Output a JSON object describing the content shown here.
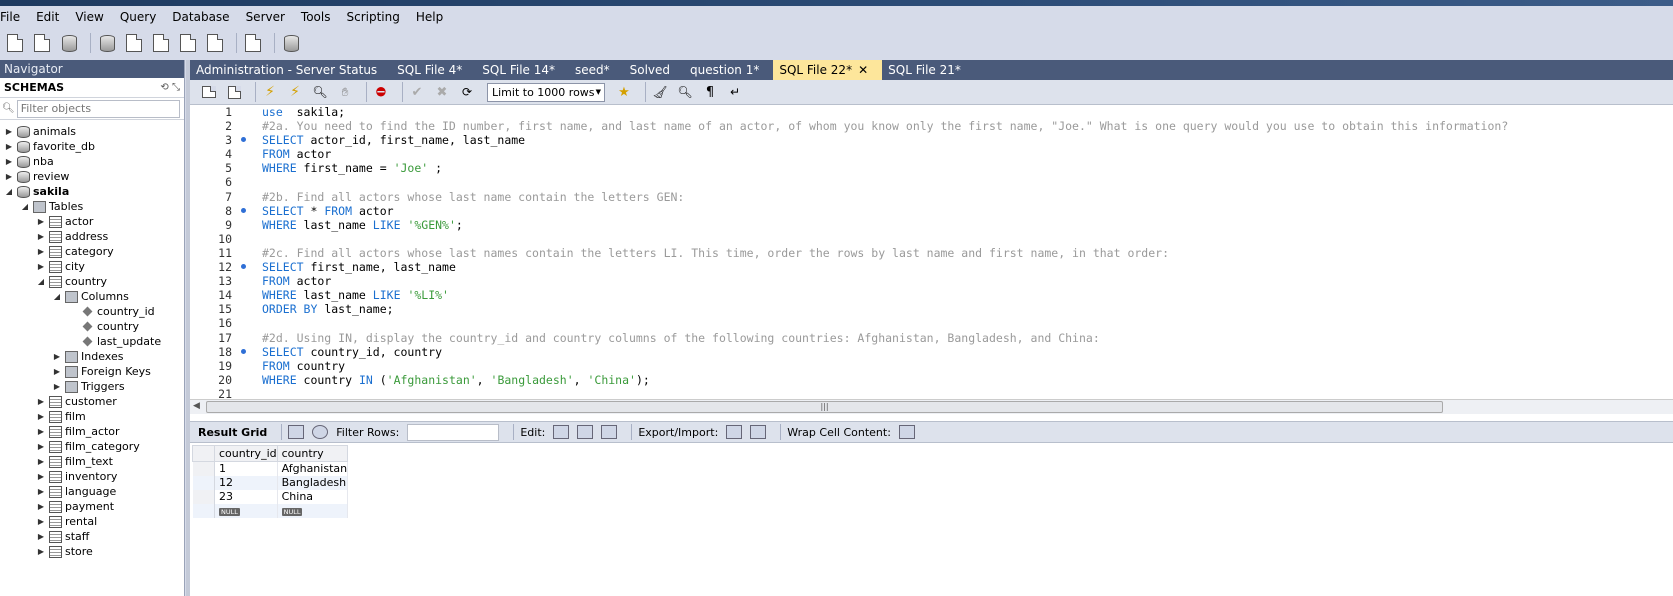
{
  "menu": [
    "File",
    "Edit",
    "View",
    "Query",
    "Database",
    "Server",
    "Tools",
    "Scripting",
    "Help"
  ],
  "navigator": {
    "title": "Navigator",
    "schemas_label": "SCHEMAS",
    "filter_placeholder": "Filter objects",
    "tree": [
      {
        "label": "animals",
        "level": 0,
        "icon": "db",
        "arrow": "right"
      },
      {
        "label": "favorite_db",
        "level": 0,
        "icon": "db",
        "arrow": "right"
      },
      {
        "label": "nba",
        "level": 0,
        "icon": "db",
        "arrow": "right"
      },
      {
        "label": "review",
        "level": 0,
        "icon": "db",
        "arrow": "right"
      },
      {
        "label": "sakila",
        "level": 0,
        "icon": "db",
        "arrow": "down",
        "bold": true
      },
      {
        "label": "Tables",
        "level": 1,
        "icon": "folder",
        "arrow": "down"
      },
      {
        "label": "actor",
        "level": 2,
        "icon": "table",
        "arrow": "right"
      },
      {
        "label": "address",
        "level": 2,
        "icon": "table",
        "arrow": "right"
      },
      {
        "label": "category",
        "level": 2,
        "icon": "table",
        "arrow": "right"
      },
      {
        "label": "city",
        "level": 2,
        "icon": "table",
        "arrow": "right"
      },
      {
        "label": "country",
        "level": 2,
        "icon": "table",
        "arrow": "down"
      },
      {
        "label": "Columns",
        "level": 3,
        "icon": "folder",
        "arrow": "down"
      },
      {
        "label": "country_id",
        "level": 4,
        "icon": "column",
        "arrow": ""
      },
      {
        "label": "country",
        "level": 4,
        "icon": "column",
        "arrow": ""
      },
      {
        "label": "last_update",
        "level": 4,
        "icon": "column",
        "arrow": ""
      },
      {
        "label": "Indexes",
        "level": 3,
        "icon": "folder",
        "arrow": "right"
      },
      {
        "label": "Foreign Keys",
        "level": 3,
        "icon": "folder",
        "arrow": "right"
      },
      {
        "label": "Triggers",
        "level": 3,
        "icon": "folder",
        "arrow": "right"
      },
      {
        "label": "customer",
        "level": 2,
        "icon": "table",
        "arrow": "right"
      },
      {
        "label": "film",
        "level": 2,
        "icon": "table",
        "arrow": "right"
      },
      {
        "label": "film_actor",
        "level": 2,
        "icon": "table",
        "arrow": "right"
      },
      {
        "label": "film_category",
        "level": 2,
        "icon": "table",
        "arrow": "right"
      },
      {
        "label": "film_text",
        "level": 2,
        "icon": "table",
        "arrow": "right"
      },
      {
        "label": "inventory",
        "level": 2,
        "icon": "table",
        "arrow": "right"
      },
      {
        "label": "language",
        "level": 2,
        "icon": "table",
        "arrow": "right"
      },
      {
        "label": "payment",
        "level": 2,
        "icon": "table",
        "arrow": "right"
      },
      {
        "label": "rental",
        "level": 2,
        "icon": "table",
        "arrow": "right"
      },
      {
        "label": "staff",
        "level": 2,
        "icon": "table",
        "arrow": "right"
      },
      {
        "label": "store",
        "level": 2,
        "icon": "table",
        "arrow": "right"
      }
    ]
  },
  "tabs": [
    {
      "label": "Administration - Server Status",
      "active": false
    },
    {
      "label": "SQL File 4*",
      "active": false
    },
    {
      "label": "SQL File 14*",
      "active": false
    },
    {
      "label": "seed*",
      "active": false
    },
    {
      "label": "Solved",
      "active": false
    },
    {
      "label": "question 1*",
      "active": false
    },
    {
      "label": "SQL File 22*",
      "active": true
    },
    {
      "label": "SQL File 21*",
      "active": false
    }
  ],
  "editor_toolbar": {
    "limit_label": "Limit to 1000 rows"
  },
  "code_lines": [
    {
      "n": 1,
      "dot": false,
      "segs": [
        [
          "kw",
          "use"
        ],
        [
          "",
          "  sakila;"
        ]
      ]
    },
    {
      "n": 2,
      "dot": false,
      "segs": [
        [
          "cm",
          "#2a. You need to find the ID number, first name, and last name of an actor, of whom you know only the first name, \"Joe.\" What is one query would you use to obtain this information?"
        ]
      ]
    },
    {
      "n": 3,
      "dot": true,
      "segs": [
        [
          "kw",
          "SELECT"
        ],
        [
          "",
          " actor_id, first_name, last_name"
        ]
      ]
    },
    {
      "n": 4,
      "dot": false,
      "segs": [
        [
          "kw",
          "FROM"
        ],
        [
          "",
          " actor"
        ]
      ]
    },
    {
      "n": 5,
      "dot": false,
      "segs": [
        [
          "kw",
          "WHERE"
        ],
        [
          "",
          " first_name = "
        ],
        [
          "st",
          "'Joe'"
        ],
        [
          "",
          " ;"
        ]
      ]
    },
    {
      "n": 6,
      "dot": false,
      "segs": []
    },
    {
      "n": 7,
      "dot": false,
      "segs": [
        [
          "cm",
          "#2b. Find all actors whose last name contain the letters GEN:"
        ]
      ]
    },
    {
      "n": 8,
      "dot": true,
      "segs": [
        [
          "kw",
          "SELECT"
        ],
        [
          "",
          " * "
        ],
        [
          "kw",
          "FROM"
        ],
        [
          "",
          " actor"
        ]
      ]
    },
    {
      "n": 9,
      "dot": false,
      "segs": [
        [
          "kw",
          "WHERE"
        ],
        [
          "",
          " last_name "
        ],
        [
          "kw",
          "LIKE"
        ],
        [
          "",
          " "
        ],
        [
          "st",
          "'%GEN%'"
        ],
        [
          "",
          ";"
        ]
      ]
    },
    {
      "n": 10,
      "dot": false,
      "segs": []
    },
    {
      "n": 11,
      "dot": false,
      "segs": [
        [
          "cm",
          "#2c. Find all actors whose last names contain the letters LI. This time, order the rows by last name and first name, in that order:"
        ]
      ]
    },
    {
      "n": 12,
      "dot": true,
      "segs": [
        [
          "kw",
          "SELECT"
        ],
        [
          "",
          " first_name, last_name"
        ]
      ]
    },
    {
      "n": 13,
      "dot": false,
      "segs": [
        [
          "kw",
          "FROM"
        ],
        [
          "",
          " actor"
        ]
      ]
    },
    {
      "n": 14,
      "dot": false,
      "segs": [
        [
          "kw",
          "WHERE"
        ],
        [
          "",
          " last_name "
        ],
        [
          "kw",
          "LIKE"
        ],
        [
          "",
          " "
        ],
        [
          "st",
          "'%LI%'"
        ]
      ]
    },
    {
      "n": 15,
      "dot": false,
      "segs": [
        [
          "kw",
          "ORDER BY"
        ],
        [
          "",
          " last_name;"
        ]
      ]
    },
    {
      "n": 16,
      "dot": false,
      "segs": []
    },
    {
      "n": 17,
      "dot": false,
      "segs": [
        [
          "cm",
          "#2d. Using IN, display the country_id and country columns of the following countries: Afghanistan, Bangladesh, and China:"
        ]
      ]
    },
    {
      "n": 18,
      "dot": true,
      "segs": [
        [
          "kw",
          "SELECT"
        ],
        [
          "",
          " country_id, country"
        ]
      ]
    },
    {
      "n": 19,
      "dot": false,
      "segs": [
        [
          "kw",
          "FROM"
        ],
        [
          "",
          " country"
        ]
      ]
    },
    {
      "n": 20,
      "dot": false,
      "segs": [
        [
          "kw",
          "WHERE"
        ],
        [
          "",
          " country "
        ],
        [
          "kw",
          "IN"
        ],
        [
          "",
          " ("
        ],
        [
          "st",
          "'Afghanistan'"
        ],
        [
          "",
          ", "
        ],
        [
          "st",
          "'Bangladesh'"
        ],
        [
          "",
          ", "
        ],
        [
          "st",
          "'China'"
        ],
        [
          "",
          ");"
        ]
      ]
    },
    {
      "n": 21,
      "dot": false,
      "segs": []
    }
  ],
  "result_toolbar": {
    "result_grid": "Result Grid",
    "filter_rows": "Filter Rows:",
    "edit": "Edit:",
    "export_import": "Export/Import:",
    "wrap": "Wrap Cell Content:"
  },
  "result": {
    "columns": [
      "country_id",
      "country"
    ],
    "rows": [
      [
        "1",
        "Afghanistan"
      ],
      [
        "12",
        "Bangladesh"
      ],
      [
        "23",
        "China"
      ]
    ],
    "null_label": "NULL"
  }
}
